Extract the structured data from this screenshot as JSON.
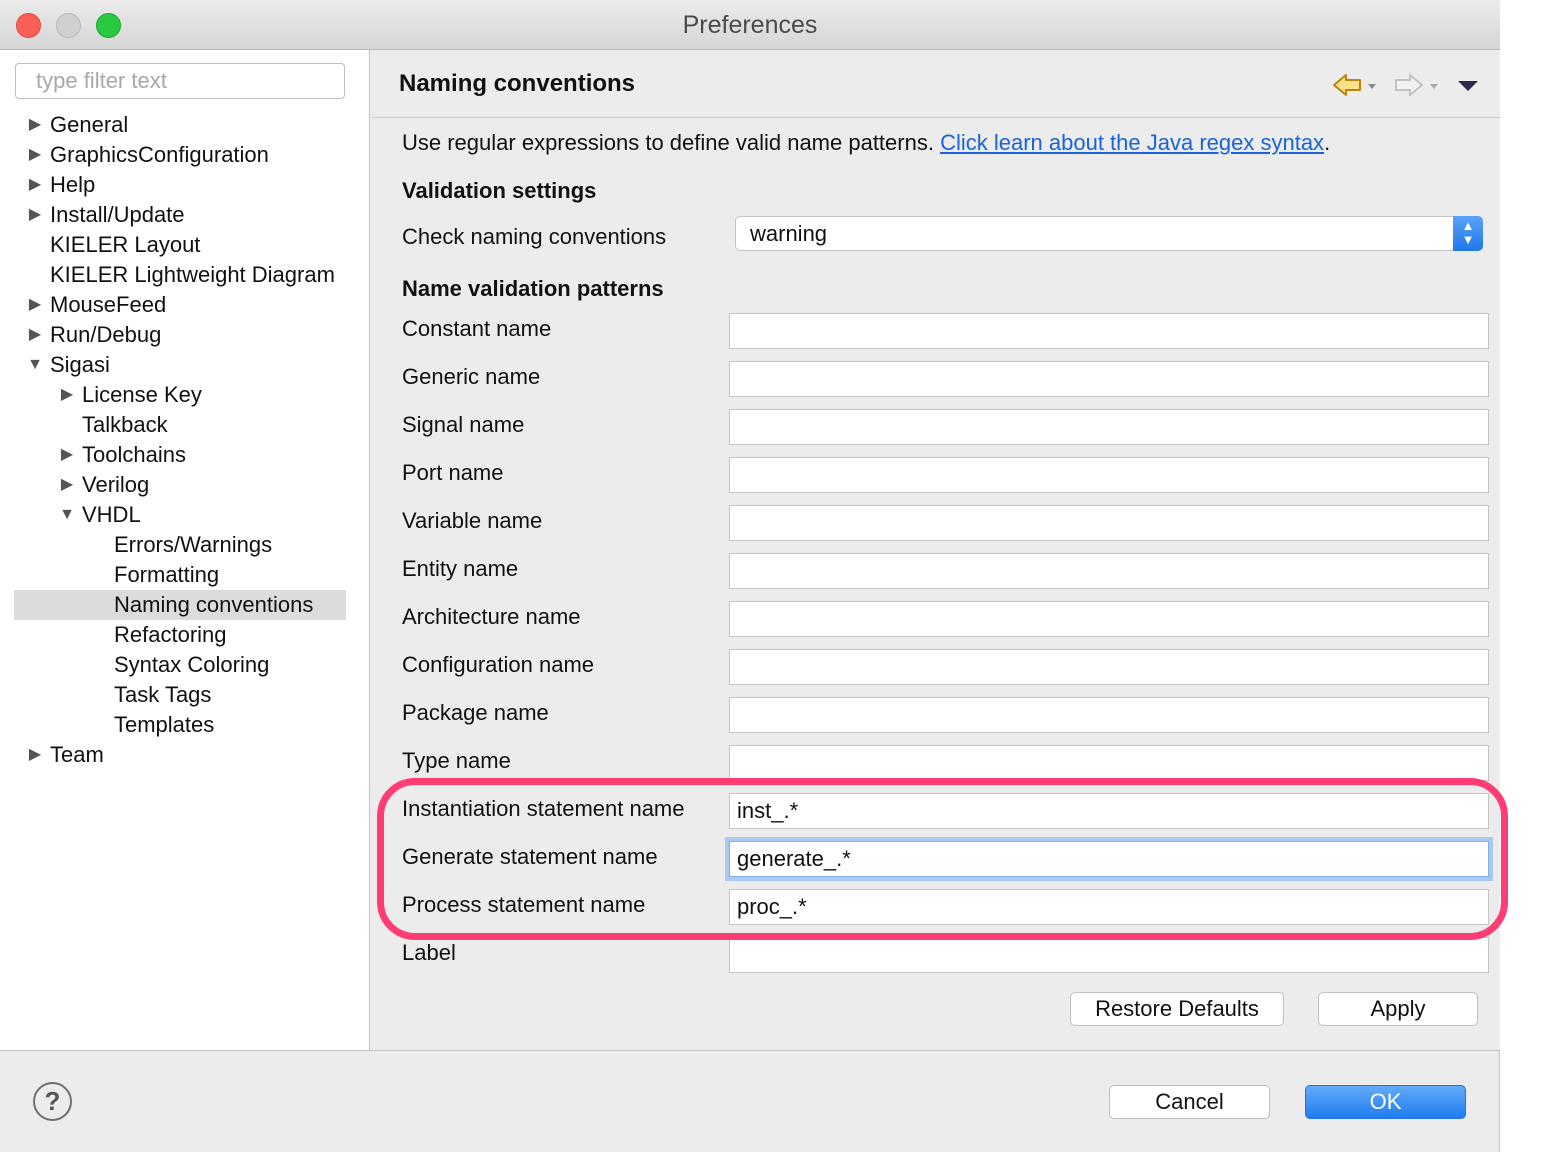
{
  "window": {
    "title": "Preferences"
  },
  "filter": {
    "placeholder": "type filter text"
  },
  "tree": [
    {
      "label": "General",
      "expander": "closed"
    },
    {
      "label": "GraphicsConfiguration",
      "expander": "closed"
    },
    {
      "label": "Help",
      "expander": "closed"
    },
    {
      "label": "Install/Update",
      "expander": "closed"
    },
    {
      "label": "KIELER Layout",
      "expander": "none"
    },
    {
      "label": "KIELER Lightweight Diagram",
      "expander": "none"
    },
    {
      "label": "MouseFeed",
      "expander": "closed"
    },
    {
      "label": "Run/Debug",
      "expander": "closed"
    },
    {
      "label": "Sigasi",
      "expander": "open"
    },
    {
      "label": "License Key",
      "expander": "closed"
    },
    {
      "label": "Talkback",
      "expander": "none"
    },
    {
      "label": "Toolchains",
      "expander": "closed"
    },
    {
      "label": "Verilog",
      "expander": "closed"
    },
    {
      "label": "VHDL",
      "expander": "open"
    },
    {
      "label": "Errors/Warnings",
      "expander": "none"
    },
    {
      "label": "Formatting",
      "expander": "none"
    },
    {
      "label": "Naming conventions",
      "expander": "none",
      "selected": true
    },
    {
      "label": "Refactoring",
      "expander": "none"
    },
    {
      "label": "Syntax Coloring",
      "expander": "none"
    },
    {
      "label": "Task Tags",
      "expander": "none"
    },
    {
      "label": "Templates",
      "expander": "none"
    },
    {
      "label": "Team",
      "expander": "closed"
    }
  ],
  "page": {
    "title": "Naming conventions",
    "intro_text": "Use regular expressions to define valid name patterns. ",
    "intro_link": "Click learn about the Java regex syntax",
    "intro_end": ".",
    "validation_heading": "Validation settings",
    "check_label": "Check naming conventions",
    "check_value": "warning",
    "patterns_heading": "Name validation patterns",
    "fields": [
      {
        "label": "Constant name",
        "value": ""
      },
      {
        "label": "Generic name",
        "value": ""
      },
      {
        "label": "Signal name",
        "value": ""
      },
      {
        "label": "Port name",
        "value": ""
      },
      {
        "label": "Variable name",
        "value": ""
      },
      {
        "label": "Entity name",
        "value": ""
      },
      {
        "label": "Architecture name",
        "value": ""
      },
      {
        "label": "Configuration name",
        "value": ""
      },
      {
        "label": "Package name",
        "value": ""
      },
      {
        "label": "Type name",
        "value": ""
      },
      {
        "label": "Instantiation statement name",
        "value": "inst_.*"
      },
      {
        "label": "Generate statement name",
        "value": "generate_.*"
      },
      {
        "label": "Process statement name",
        "value": "proc_.*"
      },
      {
        "label": "Label",
        "value": ""
      }
    ],
    "restore_label": "Restore Defaults",
    "apply_label": "Apply"
  },
  "footer": {
    "help_glyph": "?",
    "cancel_label": "Cancel",
    "ok_label": "OK"
  },
  "colors": {
    "accent": "#1f7cf0",
    "highlight": "#ff3d74",
    "link": "#1a63d6"
  },
  "icons": [
    "back-arrow-icon",
    "forward-arrow-icon",
    "view-menu-icon",
    "expand-arrow-icon",
    "help-icon",
    "select-stepper-icon"
  ]
}
